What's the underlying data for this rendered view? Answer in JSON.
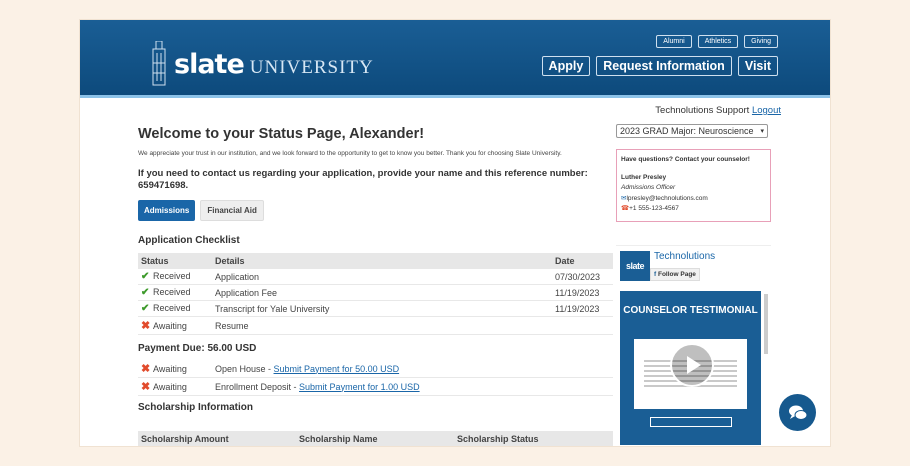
{
  "header": {
    "logo_word": "slate",
    "logo_uni": "UNIVERSITY",
    "util_links": [
      "Alumni",
      "Athletics",
      "Giving"
    ],
    "main_links": [
      "Apply",
      "Request Information",
      "Visit"
    ]
  },
  "support": {
    "text": "Technolutions Support",
    "logout": "Logout"
  },
  "main": {
    "title": "Welcome to your Status Page, Alexander!",
    "intro": "We appreciate your trust in our institution, and we look forward to the opportunity to get to know you better. Thank you for choosing Slate University.",
    "contact": "If you need to contact us regarding your application, provide your name and this reference number: 659471698.",
    "tabs": [
      "Admissions",
      "Financial Aid"
    ]
  },
  "checklist": {
    "title": "Application Checklist",
    "headers": [
      "Status",
      "Details",
      "Date"
    ],
    "rows": [
      {
        "status": "Received",
        "details": "Application",
        "date": "07/30/2023"
      },
      {
        "status": "Received",
        "details": "Application Fee",
        "date": "11/19/2023"
      },
      {
        "status": "Received",
        "details": "Transcript for Yale University",
        "date": "11/19/2023"
      },
      {
        "status": "Awaiting",
        "details": "Resume",
        "date": ""
      }
    ]
  },
  "payment": {
    "title": "Payment Due: 56.00 USD",
    "rows": [
      {
        "status": "Awaiting",
        "label": "Open House - ",
        "link": "Submit Payment for 50.00 USD"
      },
      {
        "status": "Awaiting",
        "label": "Enrollment Deposit - ",
        "link": "Submit Payment for 1.00 USD"
      }
    ]
  },
  "scholarship": {
    "title": "Scholarship Information",
    "headers": [
      "Scholarship Amount",
      "Scholarship Name",
      "Scholarship Status"
    ]
  },
  "sidebar": {
    "term_select": "2023 GRAD Major: Neuroscience",
    "counselor": {
      "heading": "Have questions?  Contact your counselor!",
      "name": "Luther Presley",
      "role": "Admissions Officer",
      "email": "lpresley@technolutions.com",
      "phone": "+1 555-123-4567"
    },
    "fb": {
      "logo": "slate",
      "name": "Technolutions",
      "follow": "Follow Page"
    },
    "video_title": "COUNSELOR TESTIMONIAL"
  },
  "colors": {
    "brand": "#1a5e95",
    "link": "#1a66a8",
    "received": "#3d9a2b",
    "awaiting": "#e14b2c"
  }
}
